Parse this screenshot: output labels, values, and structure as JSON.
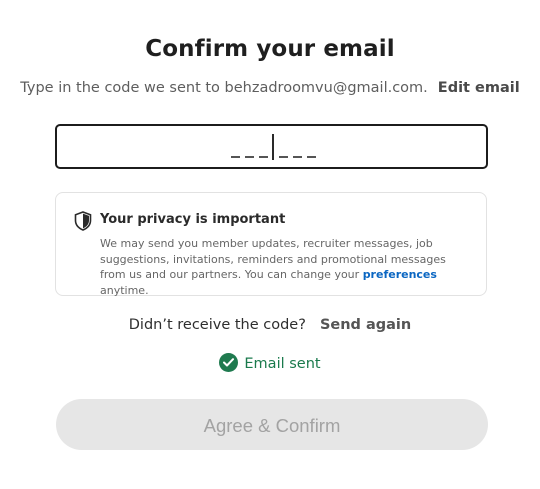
{
  "header": {
    "title": "Confirm your email",
    "subtitle_text": "Type in the code we sent to behzadroomvu@gmail.com.",
    "edit_email_label": "Edit email"
  },
  "code_input": {
    "value": "",
    "slots": 6
  },
  "privacy": {
    "title": "Your privacy is important",
    "body_before_link": "We may send you member updates, recruiter messages, job suggestions, invitations, reminders and promotional messages from us and our partners. You can change your ",
    "link_label": "preferences",
    "body_after_link": " anytime.",
    "icon": "shield-icon"
  },
  "resend": {
    "prompt": "Didn’t receive the code?",
    "action_label": "Send again"
  },
  "status": {
    "icon": "check-circle-icon",
    "text": "Email sent",
    "color": "#1f7a4f"
  },
  "submit": {
    "label": "Agree & Confirm",
    "disabled": true
  },
  "colors": {
    "link": "#0a66c2",
    "disabled_button_bg": "#e6e6e6",
    "disabled_button_text": "#a3a3a3"
  }
}
